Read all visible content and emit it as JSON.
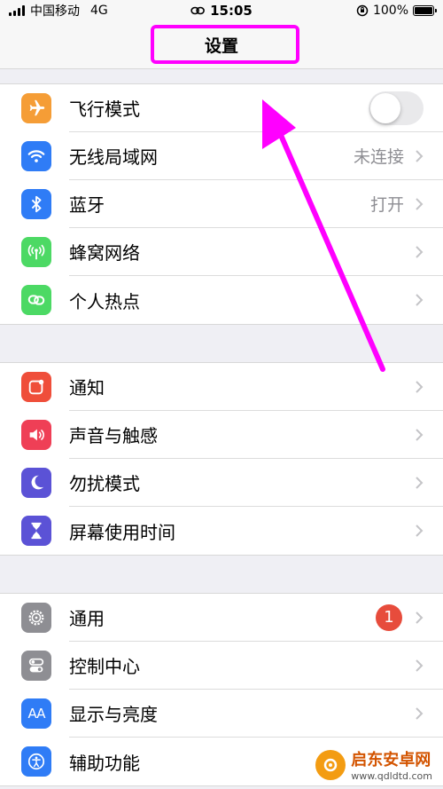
{
  "status_bar": {
    "carrier": "中国移动",
    "network": "4G",
    "time": "15:05",
    "battery": "100%",
    "battery_level": 1.0
  },
  "nav": {
    "title": "设置"
  },
  "groups": [
    {
      "items": [
        {
          "label": "飞行模式",
          "icon": "airplane-icon",
          "color": "#f59d36",
          "toggle": false
        },
        {
          "label": "无线局域网",
          "icon": "wifi-icon",
          "color": "#2f7cf6",
          "value": "未连接"
        },
        {
          "label": "蓝牙",
          "icon": "bluetooth-icon",
          "color": "#2f7cf6",
          "value": "打开"
        },
        {
          "label": "蜂窝网络",
          "icon": "cellular-icon",
          "color": "#4cd964"
        },
        {
          "label": "个人热点",
          "icon": "hotspot-icon",
          "color": "#4cd964"
        }
      ]
    },
    {
      "items": [
        {
          "label": "通知",
          "icon": "notification-icon",
          "color": "#ef4e3a"
        },
        {
          "label": "声音与触感",
          "icon": "sound-icon",
          "color": "#ef3f56"
        },
        {
          "label": "勿扰模式",
          "icon": "moon-icon",
          "color": "#5b52d6"
        },
        {
          "label": "屏幕使用时间",
          "icon": "hourglass-icon",
          "color": "#5b52d6"
        }
      ]
    },
    {
      "items": [
        {
          "label": "通用",
          "icon": "gear-icon",
          "color": "#8e8e93",
          "badge": "1"
        },
        {
          "label": "控制中心",
          "icon": "control-center-icon",
          "color": "#8e8e93"
        },
        {
          "label": "显示与亮度",
          "icon": "display-icon",
          "color": "#2f7cf6",
          "icon_text": "AA"
        },
        {
          "label": "辅助功能",
          "icon": "accessibility-icon",
          "color": "#2f7cf6"
        }
      ]
    }
  ],
  "annotation": {
    "color": "#ff00ff"
  },
  "watermark": {
    "title": "启东安卓网",
    "url": "www.qdldtd.com"
  }
}
